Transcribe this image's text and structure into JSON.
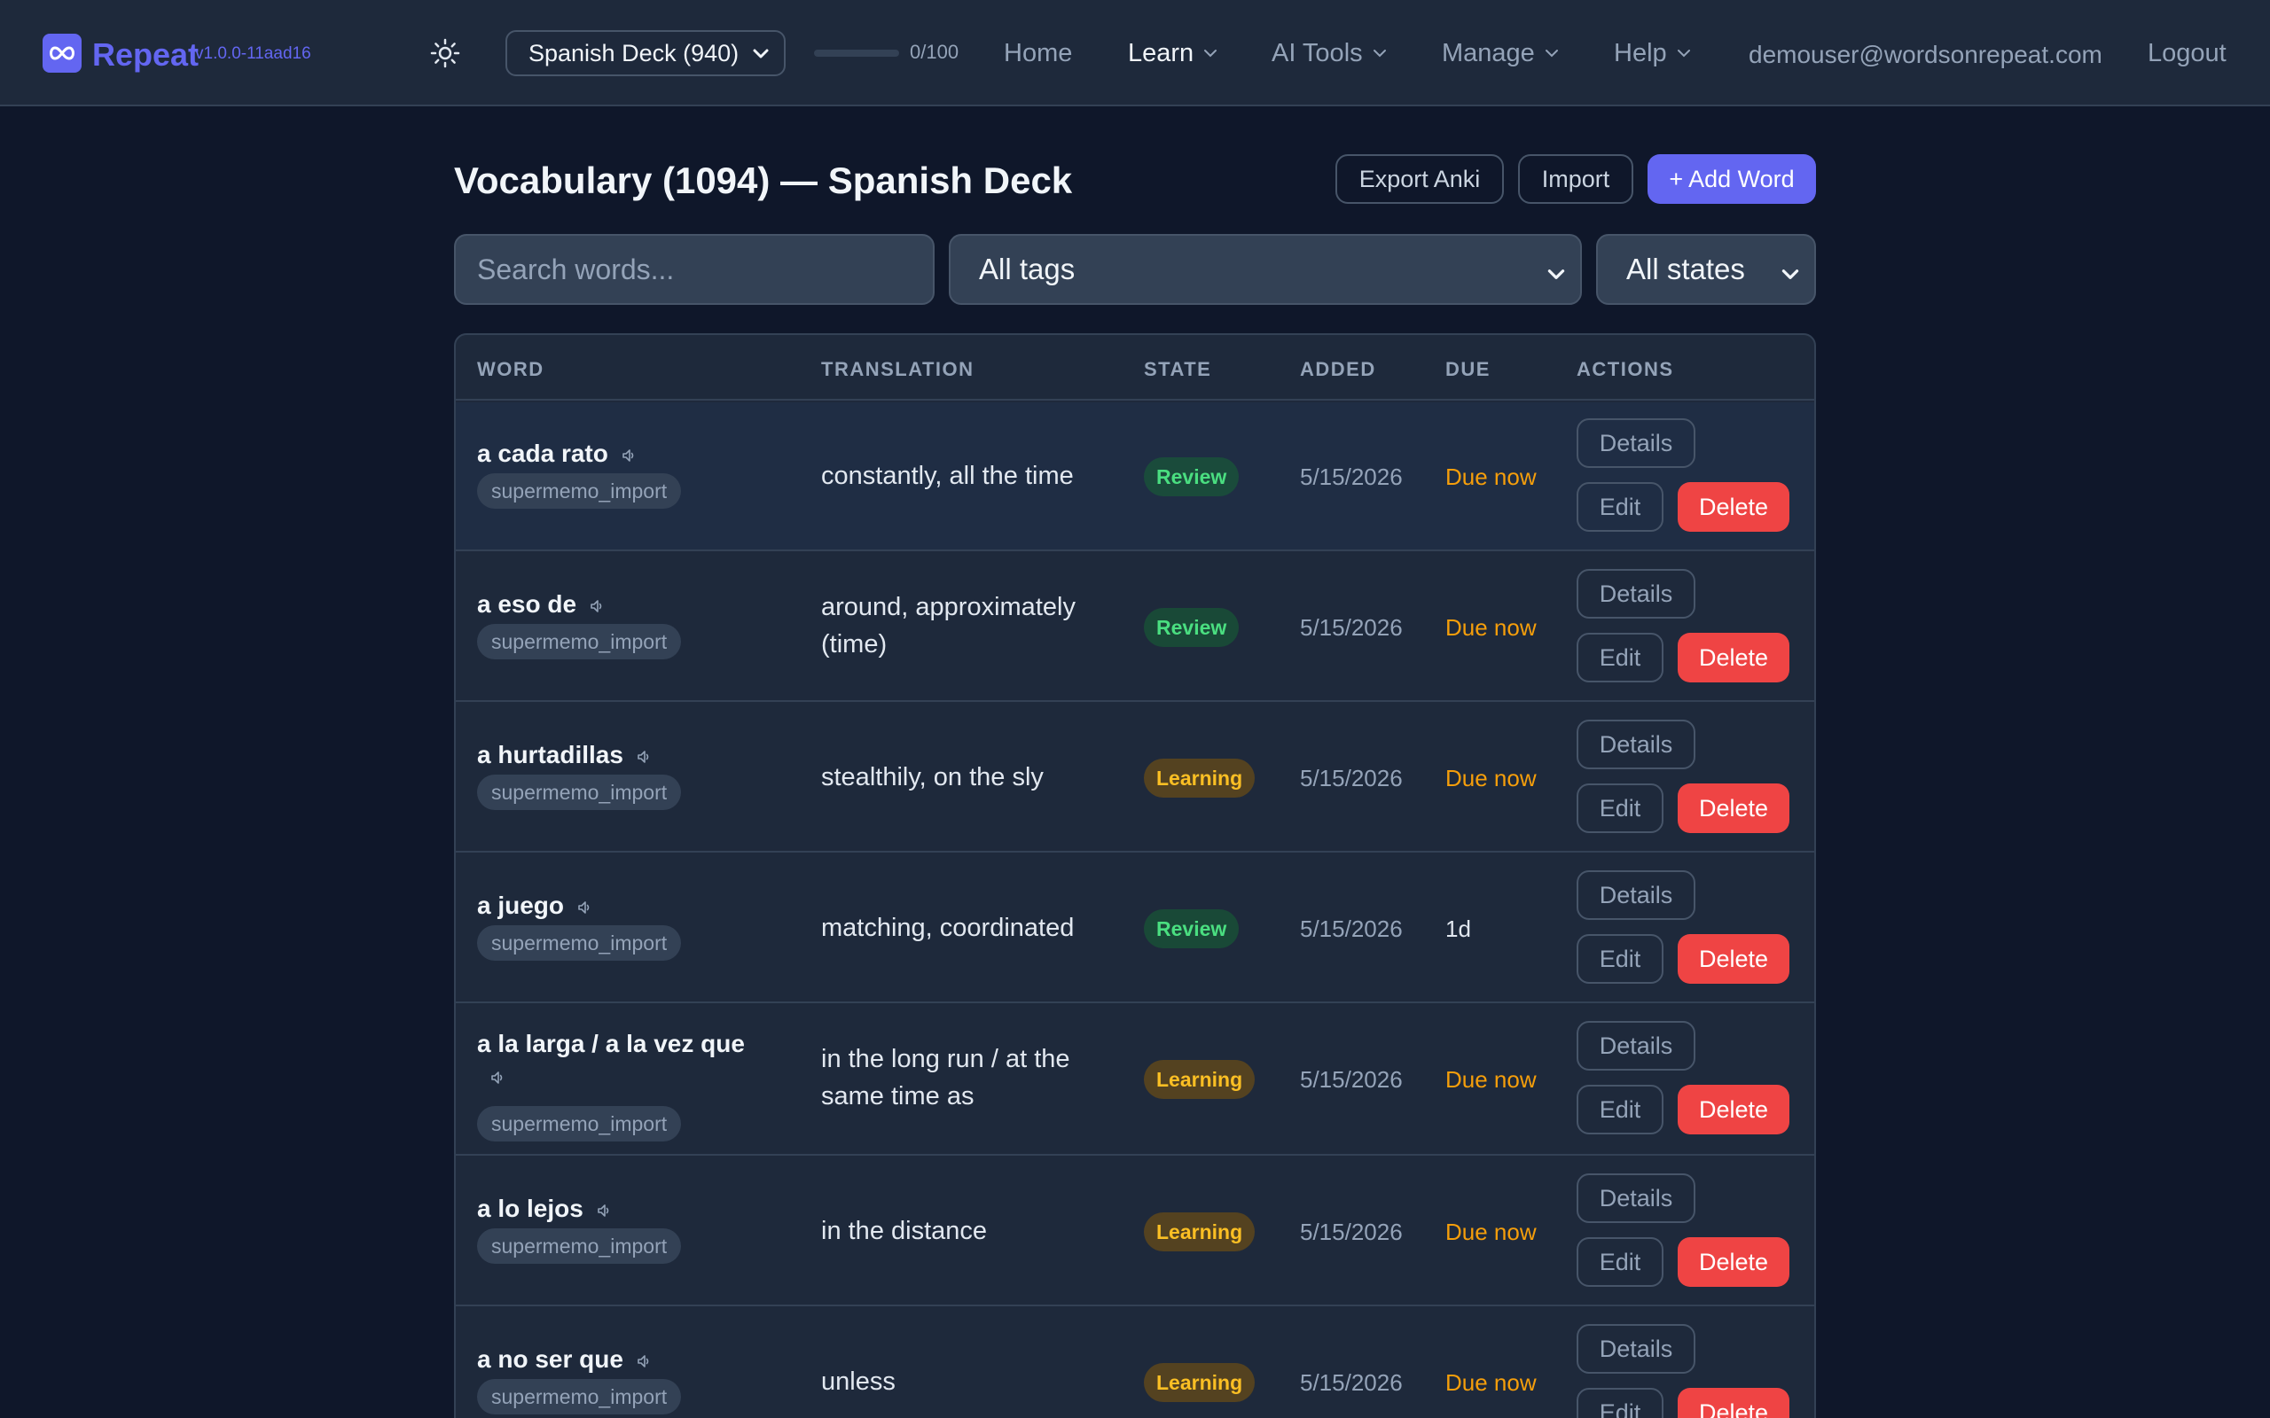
{
  "app": {
    "name": "Repeat",
    "version": "v1.0.0-11aad16",
    "accent": "#6366f1"
  },
  "nav": {
    "deck_selected": "Spanish Deck (940)",
    "progress_text": "0/100",
    "progress_fraction": 0,
    "links": {
      "home": "Home",
      "learn": "Learn",
      "ai_tools": "AI Tools",
      "manage": "Manage",
      "help": "Help"
    },
    "user_email": "demouser@wordsonrepeat.com",
    "logout": "Logout"
  },
  "page": {
    "title": "Vocabulary (1094) — Spanish Deck",
    "export_label": "Export Anki",
    "import_label": "Import",
    "add_label": "+ Add Word"
  },
  "filters": {
    "search_placeholder": "Search words...",
    "tags_selected": "All tags",
    "states_selected": "All states"
  },
  "table": {
    "headers": {
      "word": "WORD",
      "translation": "TRANSLATION",
      "state": "STATE",
      "added": "ADDED",
      "due": "DUE",
      "actions": "ACTIONS"
    },
    "action_labels": {
      "details": "Details",
      "edit": "Edit",
      "delete": "Delete"
    },
    "rows": [
      {
        "word": "a cada rato",
        "tag": "supermemo_import",
        "translation": "constantly, all the time",
        "state": "Review",
        "added": "5/15/2026",
        "due": "Due now"
      },
      {
        "word": "a eso de",
        "tag": "supermemo_import",
        "translation": "around, approximately (time)",
        "state": "Review",
        "added": "5/15/2026",
        "due": "Due now"
      },
      {
        "word": "a hurtadillas",
        "tag": "supermemo_import",
        "translation": "stealthily, on the sly",
        "state": "Learning",
        "added": "5/15/2026",
        "due": "Due now"
      },
      {
        "word": "a juego",
        "tag": "supermemo_import",
        "translation": "matching, coordinated",
        "state": "Review",
        "added": "5/15/2026",
        "due": "1d"
      },
      {
        "word": "a la larga / a la vez que",
        "tag": "supermemo_import",
        "translation": "in the long run / at the same time as",
        "state": "Learning",
        "added": "5/15/2026",
        "due": "Due now"
      },
      {
        "word": "a lo lejos",
        "tag": "supermemo_import",
        "translation": "in the distance",
        "state": "Learning",
        "added": "5/15/2026",
        "due": "Due now"
      },
      {
        "word": "a no ser que",
        "tag": "supermemo_import",
        "translation": "unless",
        "state": "Learning",
        "added": "5/15/2026",
        "due": "Due now"
      }
    ]
  }
}
